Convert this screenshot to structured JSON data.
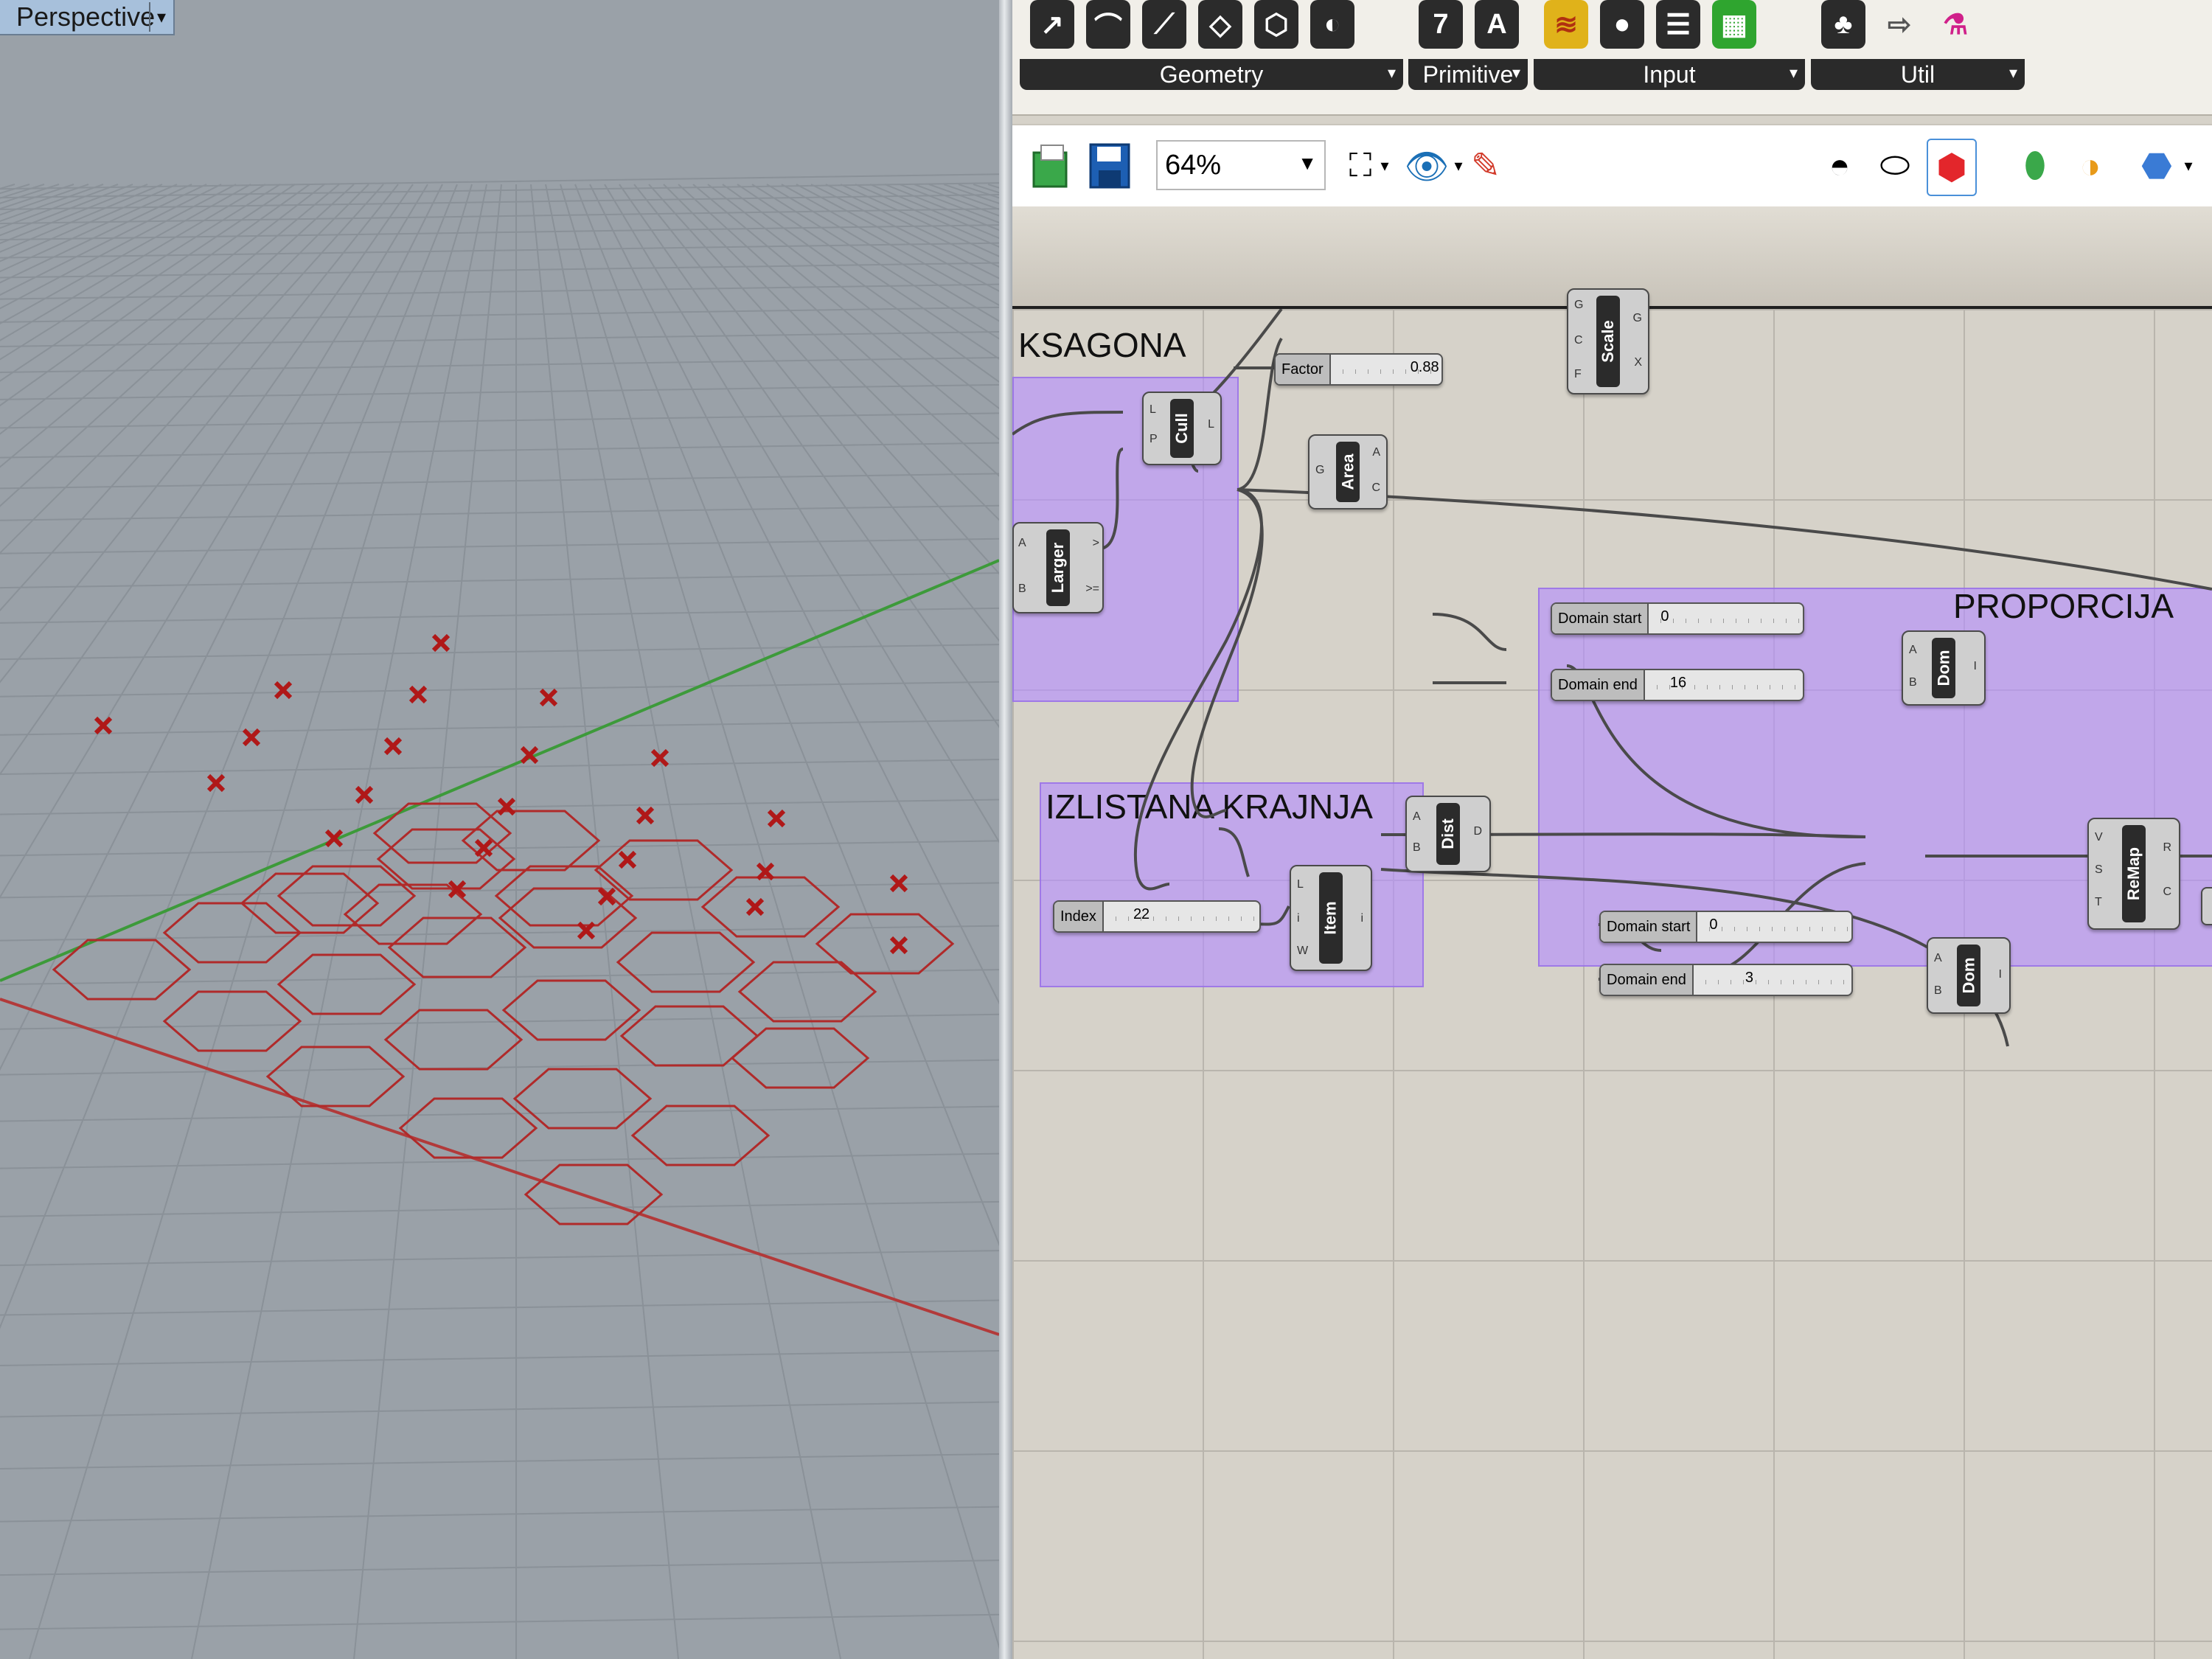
{
  "viewport": {
    "tab_label": "Perspective",
    "dropdown_glyph": "▾"
  },
  "tabs": [
    {
      "label": "Geometry",
      "icons": [
        "↗",
        "⌒",
        "⟋",
        "◇",
        "⬡",
        "◐"
      ]
    },
    {
      "label": "Primitive",
      "icons": [
        "7",
        "A"
      ]
    },
    {
      "label": "Input",
      "icons": [
        "≋",
        "●",
        "☰",
        "▦"
      ]
    },
    {
      "label": "Util",
      "icons": [
        "♣",
        "⇨",
        "⚗"
      ]
    }
  ],
  "toolbar": {
    "zoom": "64%",
    "open_icon": "open-icon",
    "save_icon": "save-icon",
    "colors": {
      "open": "#3aa84a",
      "save": "#1d5fb3",
      "preview": "#e3262b"
    }
  },
  "groups": {
    "heksagona": {
      "title": "KSAGONA"
    },
    "izlistana": {
      "title": "IZLISTANA KRAJNJA"
    },
    "proporcija": {
      "title": "PROPORCIJA"
    }
  },
  "components": {
    "scale": {
      "name": "Scale",
      "inputs": [
        "G",
        "C",
        "F"
      ],
      "outputs": [
        "G",
        "X"
      ]
    },
    "cull": {
      "name": "Cull",
      "inputs": [
        "L",
        "P"
      ],
      "outputs": [
        "L"
      ]
    },
    "area": {
      "name": "Area",
      "inputs": [
        "G"
      ],
      "outputs": [
        "A",
        "C"
      ]
    },
    "larger": {
      "name": "Larger",
      "inputs": [
        "A",
        "B"
      ],
      "outputs": [
        ">",
        ">="
      ]
    },
    "dist": {
      "name": "Dist",
      "inputs": [
        "A",
        "B"
      ],
      "outputs": [
        "D"
      ]
    },
    "item": {
      "name": "Item",
      "inputs": [
        "L",
        "i",
        "W"
      ],
      "outputs": [
        "i"
      ]
    },
    "dom1": {
      "name": "Dom",
      "inputs": [
        "A",
        "B"
      ],
      "outputs": [
        "I"
      ]
    },
    "dom2": {
      "name": "Dom",
      "inputs": [
        "A",
        "B"
      ],
      "outputs": [
        "I"
      ]
    },
    "remap": {
      "name": "ReMap",
      "inputs": [
        "V",
        "S",
        "T"
      ],
      "outputs": [
        "R",
        "C"
      ]
    }
  },
  "sliders": {
    "factor": {
      "label": "Factor",
      "value": "0.88",
      "fraction": 0.88
    },
    "index": {
      "label": "Index",
      "value": "22",
      "fraction": 0.3
    },
    "dom_start_1": {
      "label": "Domain start",
      "value": "0",
      "fraction": 0.0
    },
    "dom_end_1": {
      "label": "Domain end",
      "value": "16",
      "fraction": 0.1
    },
    "dom_start_2": {
      "label": "Domain start",
      "value": "0",
      "fraction": 0.0
    },
    "dom_end_2": {
      "label": "Domain end",
      "value": "3",
      "fraction": 0.3
    }
  }
}
